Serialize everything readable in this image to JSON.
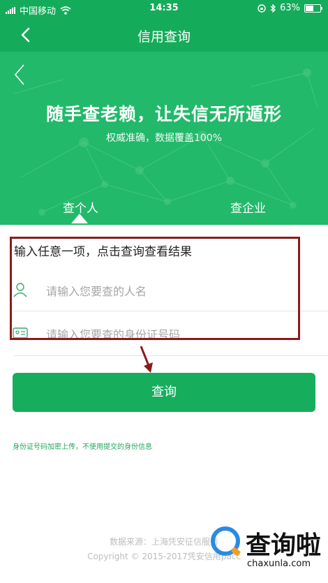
{
  "status_bar": {
    "carrier": "中国移动",
    "time": "14:35",
    "battery": "63%",
    "battery_level": 0.63
  },
  "nav": {
    "title": "信用查询"
  },
  "hero": {
    "headline": "随手查老赖，让失信无所遁形",
    "subtitle": "权威准确，数据覆盖100%",
    "tabs": [
      {
        "label": "查个人",
        "selected": true
      },
      {
        "label": "查企业",
        "selected": false
      }
    ]
  },
  "form": {
    "hint": "输入任意一项，点击查询查看结果",
    "name_placeholder": "请输入您要查的人名",
    "id_placeholder": "请输入您要查的身份证号码"
  },
  "query_button": "查询",
  "notice": "身份证号码加密上传，不使用提交的身份信息",
  "footer": {
    "source": "数据来源：上海凭安征信服务",
    "copyright": "Copyright © 2015-2017凭安信用pacc"
  },
  "watermark": {
    "brand": "查询啦",
    "url": "chaxunla.com"
  },
  "colors": {
    "nav_green": "#14ac5a",
    "hero_green": "#22b96a",
    "highlight_border": "#8a1b1b"
  }
}
